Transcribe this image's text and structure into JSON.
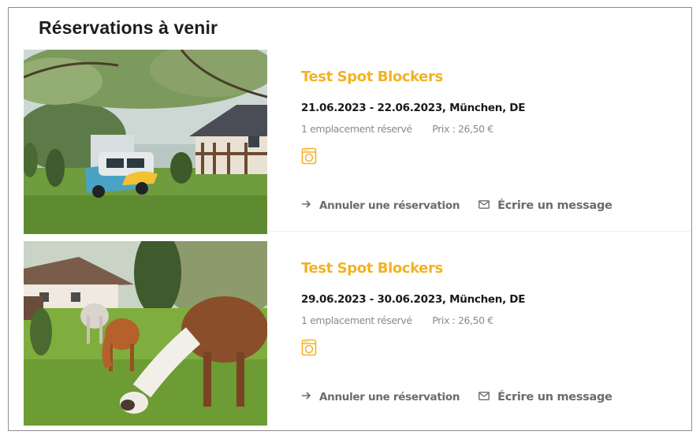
{
  "page": {
    "title": "Réservations à venir"
  },
  "reservations": [
    {
      "title": "Test Spot Blockers",
      "dates_location": "21.06.2023 - 22.06.2023, München, DE",
      "spots": "1 emplacement réservé",
      "price": "Prix : 26,50 €",
      "amenity_icon": "washing-machine-icon",
      "image": "camper-van-in-garden-photo",
      "cancel_label": "Annuler une réservation",
      "message_label": "Écrire un message"
    },
    {
      "title": "Test Spot Blockers",
      "dates_location": "29.06.2023 - 30.06.2023, München, DE",
      "spots": "1 emplacement réservé",
      "price": "Prix : 26,50 €",
      "amenity_icon": "washing-machine-icon",
      "image": "llamas-grazing-photo",
      "cancel_label": "Annuler une réservation",
      "message_label": "Écrire un message"
    }
  ],
  "colors": {
    "accent": "#f2b225",
    "text": "#1a1a1a",
    "muted": "#8a8a8a",
    "action": "#6b6b6b"
  }
}
